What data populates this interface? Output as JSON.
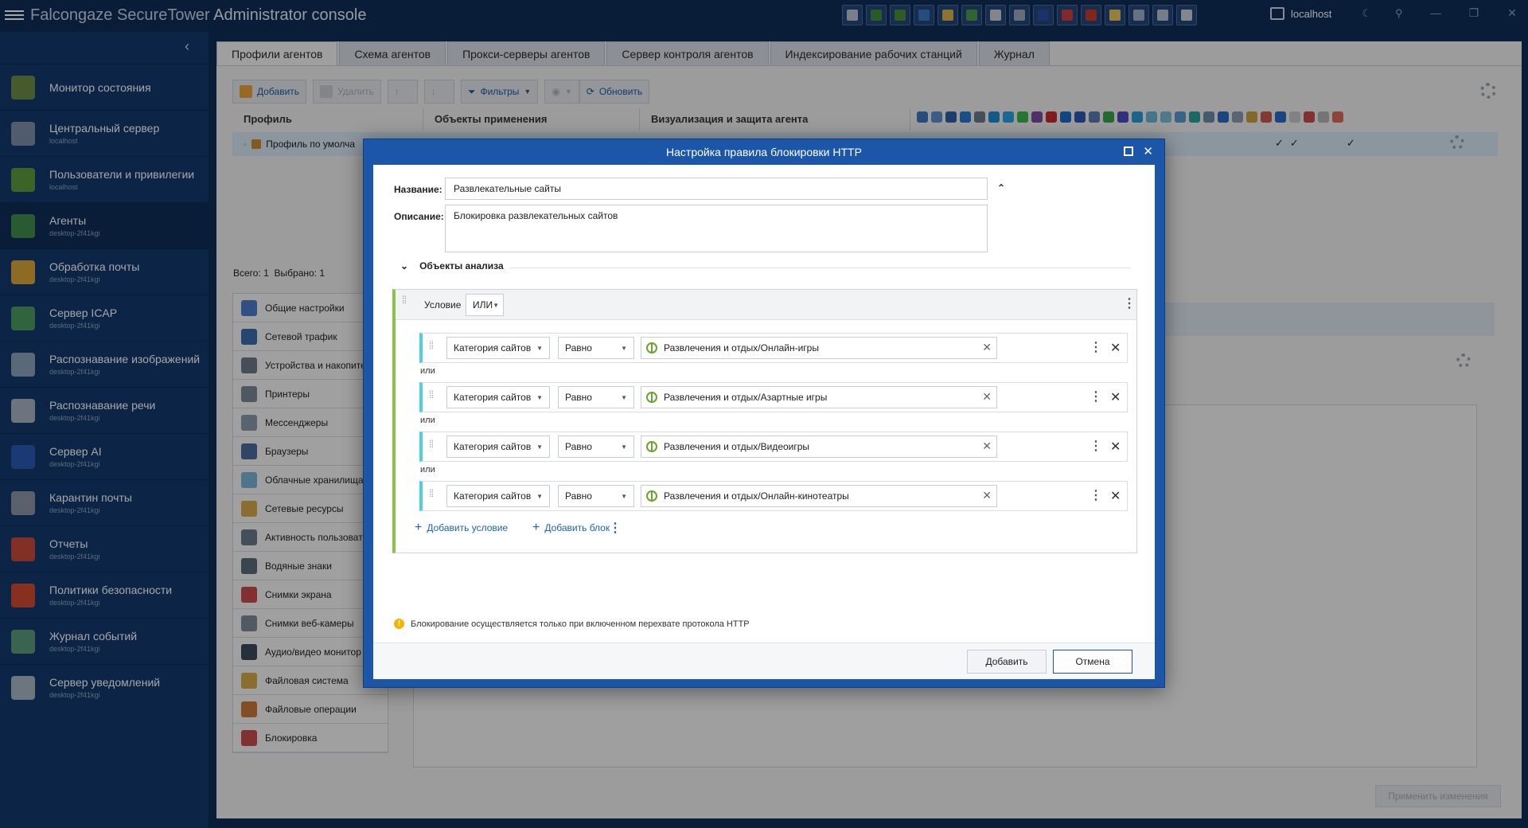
{
  "titlebar": {
    "title_main": "Falcongaze SecureTower",
    "title_sub": "Administrator console",
    "server": "localhost",
    "icon_colors": [
      "#b9c4d4",
      "#3c8c3c",
      "#4a8c3a",
      "#3a78c4",
      "#d8b24a",
      "#4a9a4a",
      "#c8ccd4",
      "#9aa8ba",
      "#2b4fa0",
      "#c84040",
      "#c83a2a",
      "#e6c35a",
      "#9ab0c8",
      "#b4c0d0",
      "#c8d0da"
    ]
  },
  "sidebar": {
    "items": [
      {
        "label": "Монитор состояния",
        "sub": "",
        "icon": "monitor-icon",
        "color": "#6a8d45"
      },
      {
        "label": "Центральный сервер",
        "sub": "localhost",
        "icon": "shield-icon",
        "color": "#7d8fa6"
      },
      {
        "label": "Пользователи и привилегии",
        "sub": "localhost",
        "icon": "users-icon",
        "color": "#5c9a3e"
      },
      {
        "label": "Агенты",
        "sub": "desktop-2f41kgi",
        "icon": "agents-icon",
        "color": "#3f8a4a"
      },
      {
        "label": "Обработка почты",
        "sub": "desktop-2f41kgi",
        "icon": "mail-icon",
        "color": "#d9a53a"
      },
      {
        "label": "Сервер ICAP",
        "sub": "desktop-2f41kgi",
        "icon": "icap-icon",
        "color": "#4a9a5a"
      },
      {
        "label": "Распознавание изображений",
        "sub": "desktop-2f41kgi",
        "icon": "image-recognition-icon",
        "color": "#8aa0b8"
      },
      {
        "label": "Распознавание речи",
        "sub": "desktop-2f41kgi",
        "icon": "speech-icon",
        "color": "#a7b2c0"
      },
      {
        "label": "Сервер AI",
        "sub": "desktop-2f41kgi",
        "icon": "ai-icon",
        "color": "#2a5ab4"
      },
      {
        "label": "Карантин почты",
        "sub": "desktop-2f41kgi",
        "icon": "quarantine-icon",
        "color": "#8a96a8"
      },
      {
        "label": "Отчеты",
        "sub": "desktop-2f41kgi",
        "icon": "reports-icon",
        "color": "#c84a3a"
      },
      {
        "label": "Политики безопасности",
        "sub": "desktop-2f41kgi",
        "icon": "policy-icon",
        "color": "#d04a30"
      },
      {
        "label": "Журнал событий",
        "sub": "desktop-2f41kgi",
        "icon": "event-log-icon",
        "color": "#5a9a7a"
      },
      {
        "label": "Сервер уведомлений",
        "sub": "desktop-2f41kgi",
        "icon": "notify-icon",
        "color": "#a8b4c4"
      }
    ]
  },
  "tabs": [
    "Профили агентов",
    "Схема агентов",
    "Прокси-серверы агентов",
    "Сервер контроля агентов",
    "Индексирование рабочих станций",
    "Журнал"
  ],
  "toolbar": {
    "add": "Добавить",
    "delete": "Удалить",
    "filters": "Фильтры",
    "refresh": "Обновить"
  },
  "grid": {
    "headers": [
      "Профиль",
      "Объекты применения",
      "Визуализация и защита агента"
    ],
    "row_profile": "Профиль по умолча",
    "checks": [
      "✓",
      "✓",
      "✓"
    ],
    "perm_icon_colors": [
      "#3a78c4",
      "#5b8fd0",
      "#2f5fa8",
      "#2878d0",
      "#6a7a8c",
      "#1c8ad4",
      "#2aa0e0",
      "#3ab54a",
      "#7a4aa0",
      "#c82a2a",
      "#1a6ac8",
      "#2a5ab4",
      "#5a7ab0",
      "#3aa04a",
      "#4a4ac0",
      "#2a9ad4",
      "#6ab4d4",
      "#7abcd8",
      "#5a9ad0",
      "#2aa0a0",
      "#6a8aa8",
      "#2a6ac0",
      "#8a9ab0",
      "#c8a040",
      "#c85a4a",
      "#2a6ac8",
      "#c8c8c8",
      "#c84a4a",
      "#b4b4b4",
      "#d86a5a"
    ]
  },
  "counts": {
    "total_label": "Всего:",
    "total": "1",
    "selected_label": "Выбрано:",
    "selected": "1"
  },
  "settings_list": [
    {
      "label": "Общие настройки",
      "color": "#4a7ac8"
    },
    {
      "label": "Сетевой трафик",
      "color": "#3a6ab0"
    },
    {
      "label": "Устройства и накопите",
      "color": "#6a7a8a"
    },
    {
      "label": "Принтеры",
      "color": "#7a8696"
    },
    {
      "label": "Мессенджеры",
      "color": "#8a9aaa"
    },
    {
      "label": "Браузеры",
      "color": "#4a6aa0"
    },
    {
      "label": "Облачные хранилища",
      "color": "#7ab4d8"
    },
    {
      "label": "Сетевые ресурсы",
      "color": "#d8a84a"
    },
    {
      "label": "Активность пользоват",
      "color": "#6a7a8a"
    },
    {
      "label": "Водяные знаки",
      "color": "#5a6a7a"
    },
    {
      "label": "Снимки экрана",
      "color": "#c84a4a"
    },
    {
      "label": "Снимки веб-камеры",
      "color": "#7a8a9a"
    },
    {
      "label": "Аудио/видео монитор",
      "color": "#3a4a5a"
    },
    {
      "label": "Файловая система",
      "color": "#d8a84a"
    },
    {
      "label": "Файловые операции",
      "color": "#c87a3a"
    },
    {
      "label": "Блокировка",
      "color": "#c84a4a"
    }
  ],
  "apply_button": "Применить изменения",
  "modal": {
    "title": "Настройка правила блокировки HTTP",
    "name_label": "Название:",
    "name_value": "Развлекательные сайты",
    "desc_label": "Описание:",
    "desc_value": "Блокировка развлекательных сайтов",
    "section": "Объекты анализа",
    "condition_label": "Условие",
    "condition_op": "ИЛИ",
    "or_label": "или",
    "conditions": [
      {
        "field": "Категория сайтов",
        "op": "Равно",
        "value": "Развлечения и отдых/Онлайн-игры"
      },
      {
        "field": "Категория сайтов",
        "op": "Равно",
        "value": "Развлечения и отдых/Азартные игры"
      },
      {
        "field": "Категория сайтов",
        "op": "Равно",
        "value": "Развлечения и отдых/Видеоигры"
      },
      {
        "field": "Категория сайтов",
        "op": "Равно",
        "value": "Развлечения и отдых/Онлайн-кинотеатры"
      }
    ],
    "add_condition": "Добавить условие",
    "add_block": "Добавить блок",
    "warning": "Блокирование осуществляется только при включенном перехвате протокола HTTP",
    "ok": "Добавить",
    "cancel": "Отмена"
  }
}
